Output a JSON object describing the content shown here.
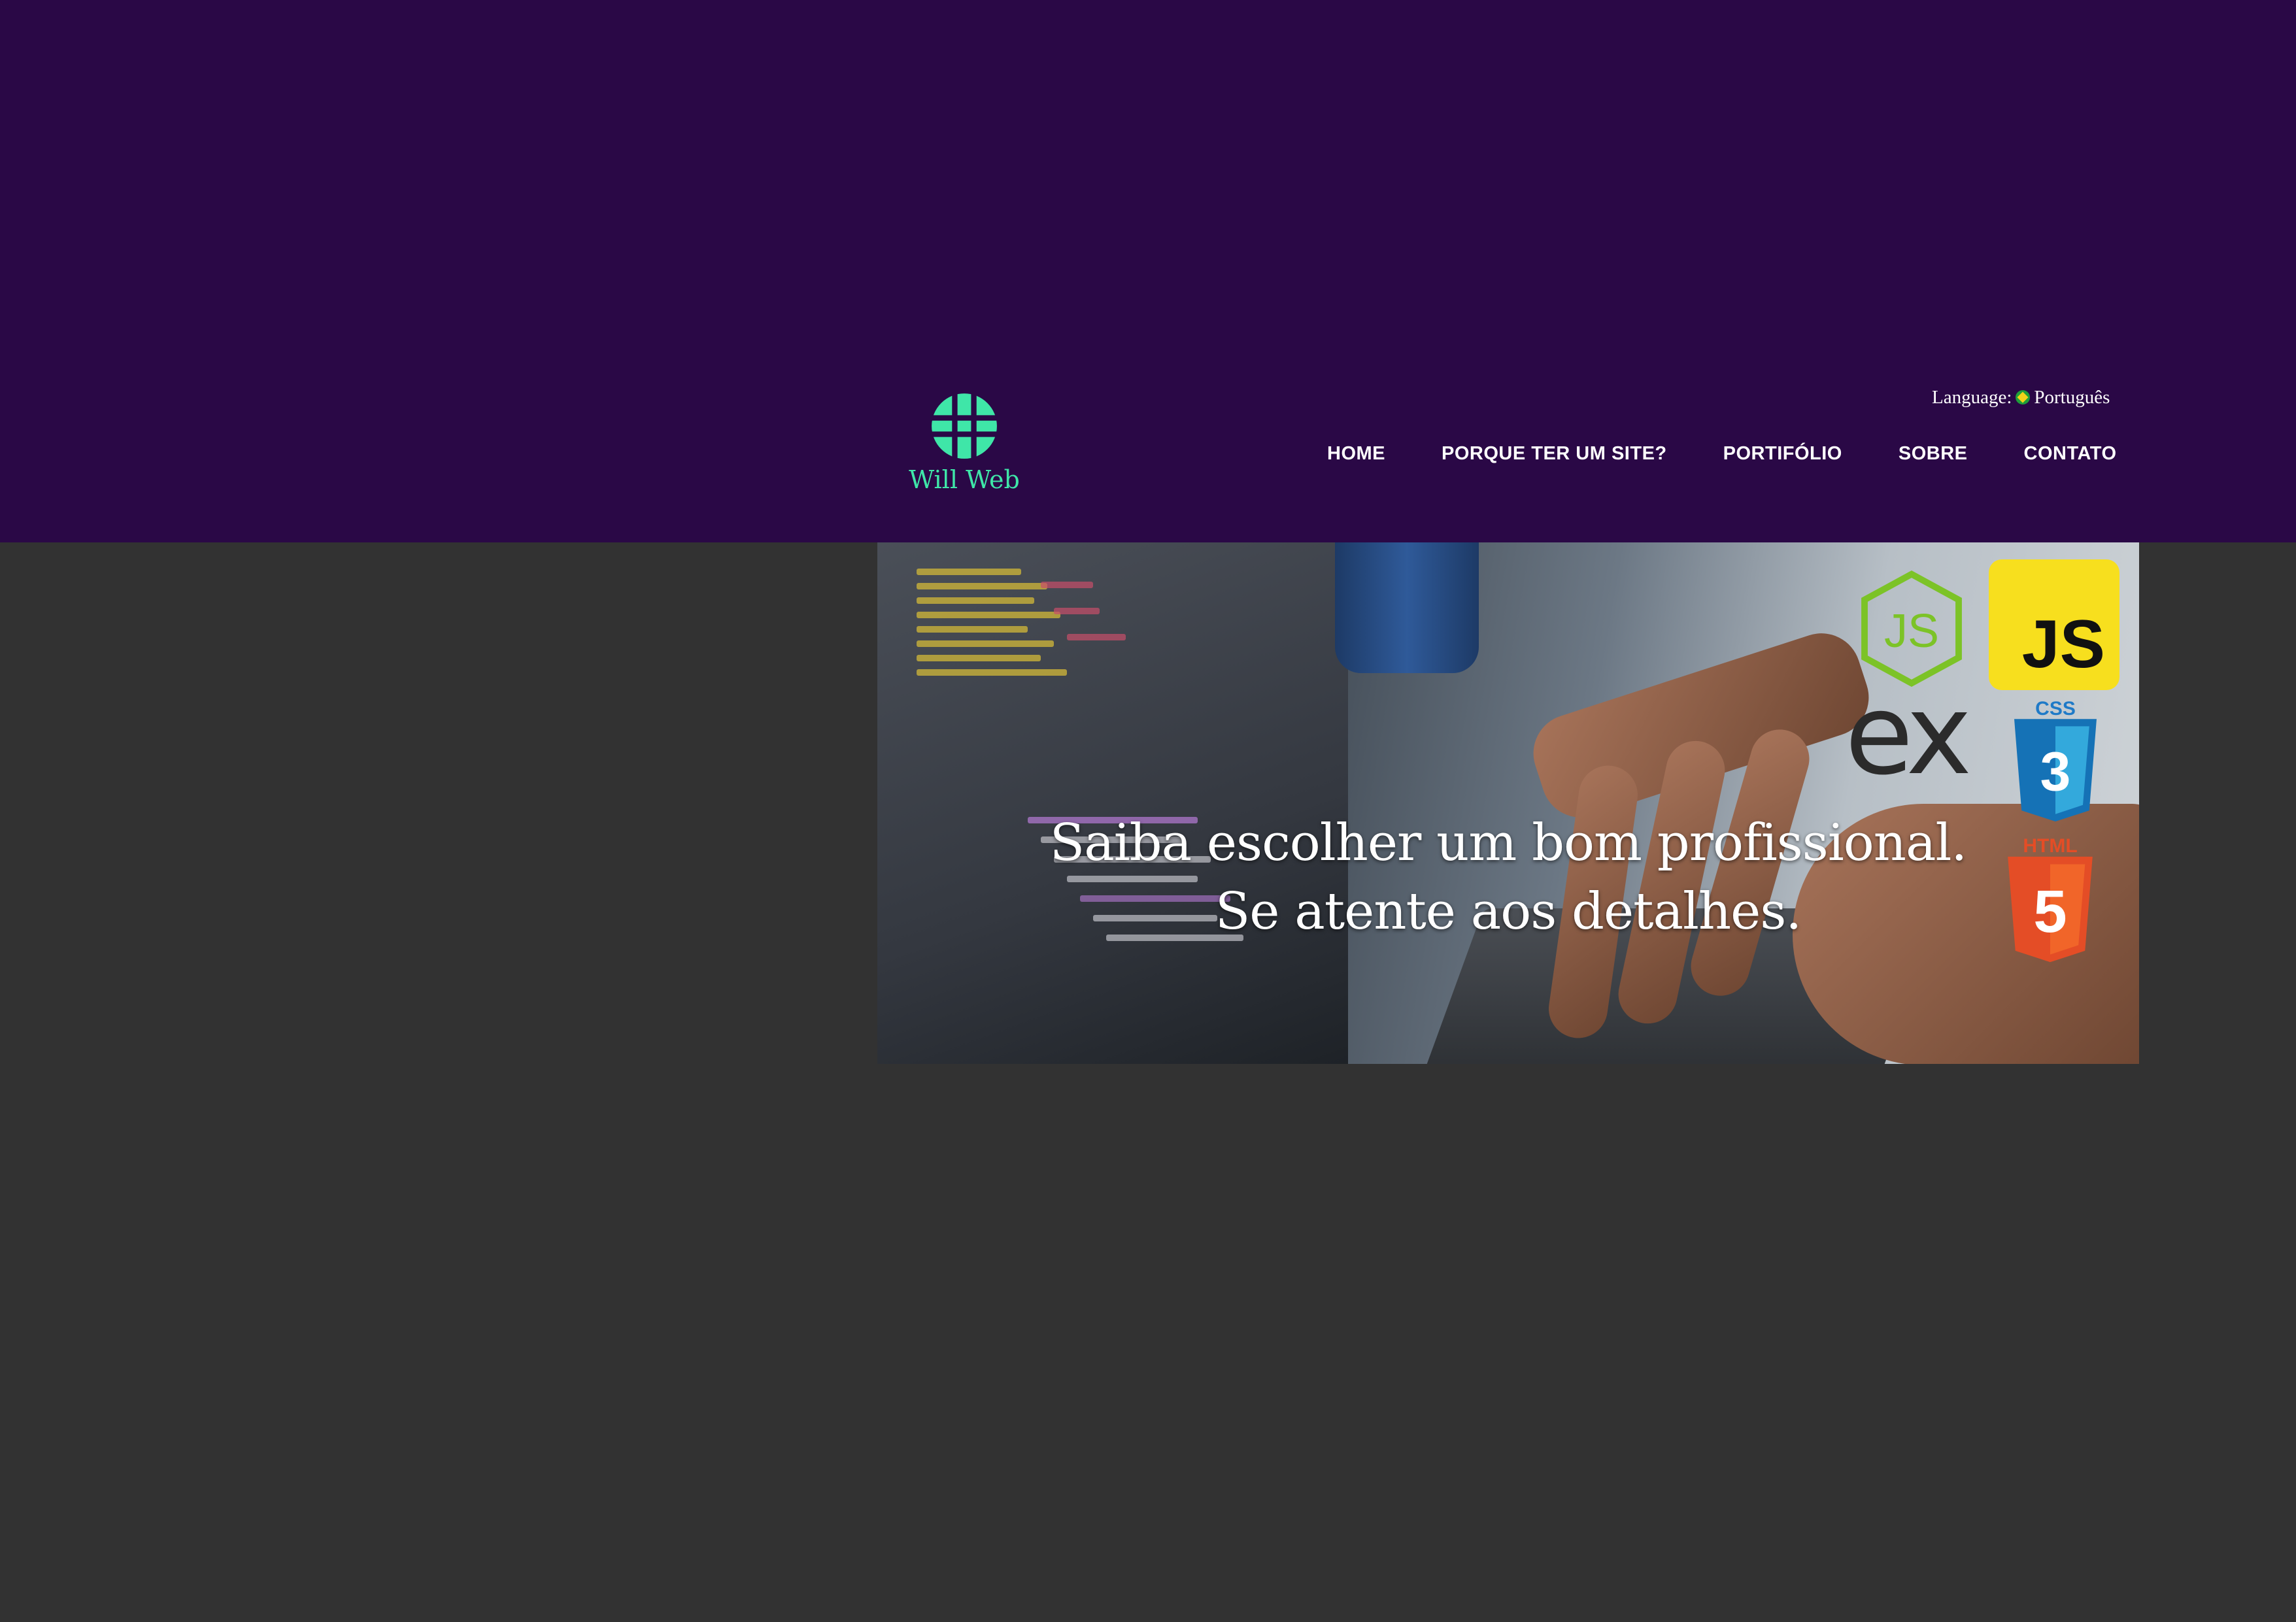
{
  "brand": {
    "name": "Will Web",
    "logo_icon": "globe-icon",
    "accent": "#3fe6a8"
  },
  "language": {
    "label": "Language:",
    "flag_icon": "brazil-flag-icon",
    "value": "Português"
  },
  "nav": {
    "items": [
      {
        "label": "HOME"
      },
      {
        "label": "PORQUE TER UM SITE?"
      },
      {
        "label": "PORTIFÓLIO"
      },
      {
        "label": "SOBRE"
      },
      {
        "label": "CONTATO"
      }
    ]
  },
  "hero": {
    "line1": "Saiba escolher um bom profissional.",
    "line2": "Se atente aos detalhes.",
    "tech_icons": [
      "nodejs-icon",
      "javascript-icon",
      "express-icon",
      "css3-icon",
      "html5-icon"
    ],
    "icon_labels": {
      "js": "JS",
      "ex": "ex",
      "css": "CSS",
      "html": "HTML"
    }
  },
  "colors": {
    "header_bg": "#2a0846",
    "page_bg": "#323232"
  }
}
